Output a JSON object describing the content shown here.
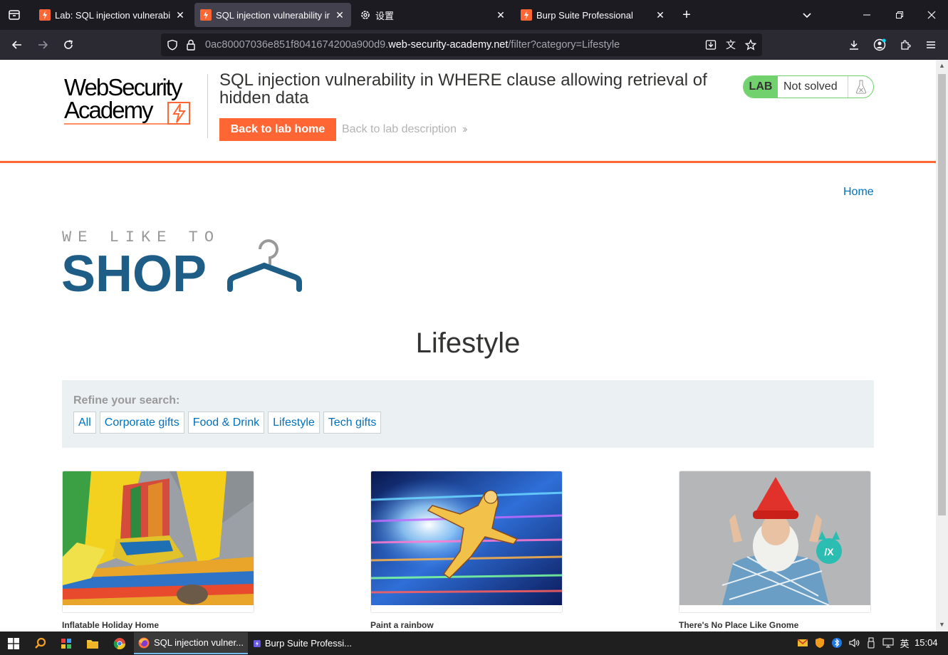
{
  "browser": {
    "tabs": [
      {
        "title": "Lab: SQL injection vulnerabili",
        "active": false
      },
      {
        "title": "SQL injection vulnerability in",
        "active": true
      },
      {
        "title": "设置",
        "active": false
      },
      {
        "title": "Burp Suite Professional",
        "active": false
      }
    ],
    "url_dim": "0ac80007036e851f8041674200a900d9.",
    "url_domain": "web-security-academy.net",
    "url_path": "/filter?category=Lifestyle"
  },
  "lab": {
    "logo_line1": "WebSecurity",
    "logo_line2": "Academy",
    "title": "SQL injection vulnerability in WHERE clause allowing retrieval of hidden data",
    "back_home": "Back to lab home",
    "back_description": "Back to lab description",
    "badge": "LAB",
    "status": "Not solved",
    "accent": "#ff6633",
    "status_color": "#70d16d"
  },
  "shop": {
    "home_link": "Home",
    "logo_top": "WE LIKE TO",
    "logo_bottom": "SHOP",
    "heading": "Lifestyle",
    "refine_label": "Refine your search:",
    "categories": [
      "All",
      "Corporate gifts",
      "Food & Drink",
      "Lifestyle",
      "Tech gifts"
    ],
    "products": [
      {
        "name": "Inflatable Holiday Home"
      },
      {
        "name": "Paint a rainbow"
      },
      {
        "name": "There's No Place Like Gnome"
      }
    ],
    "link_color": "#0071bc"
  },
  "taskbar": {
    "apps": [
      "SQL injection vulner...",
      "Burp Suite Professi..."
    ],
    "ime": "英",
    "time": "15:04"
  }
}
